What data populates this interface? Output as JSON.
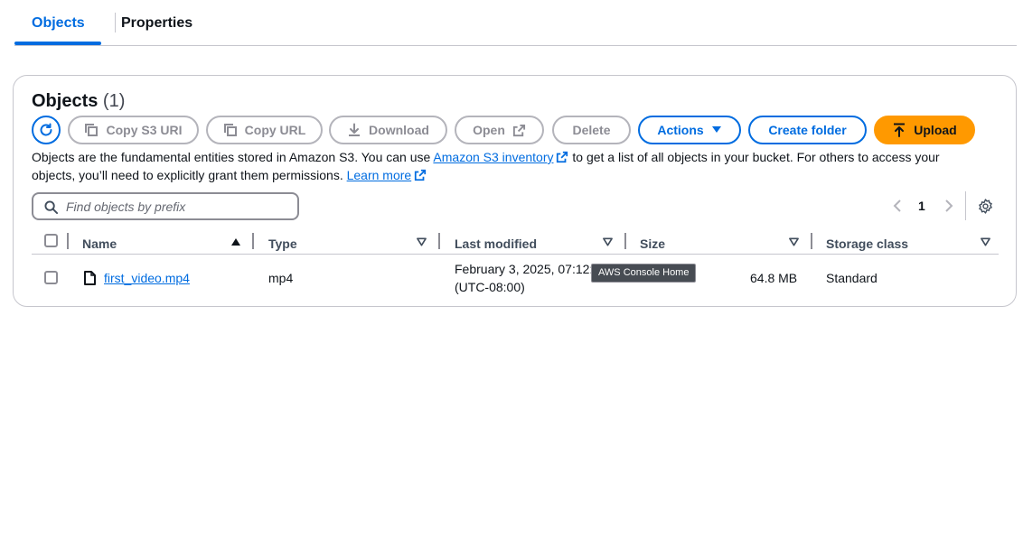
{
  "tabs": [
    {
      "label": "Objects",
      "active": true
    },
    {
      "label": "Properties",
      "active": false
    }
  ],
  "header": {
    "title": "Objects",
    "count": "(1)"
  },
  "toolbar": {
    "copy_s3_uri": "Copy S3 URI",
    "copy_url": "Copy URL",
    "download": "Download",
    "open": "Open",
    "delete": "Delete",
    "actions": "Actions",
    "create_folder": "Create folder",
    "upload": "Upload"
  },
  "description": {
    "part1": "Objects are the fundamental entities stored in Amazon S3. You can use ",
    "inventory_link": "Amazon S3 inventory",
    "part2": " to get a list of all objects in your bucket. For others to access your objects, you’ll need to explicitly grant them permissions. ",
    "learn_more": "Learn more"
  },
  "search": {
    "placeholder": "Find objects by prefix",
    "value": ""
  },
  "pagination": {
    "current_page": "1"
  },
  "table": {
    "columns": [
      "Name",
      "Type",
      "Last modified",
      "Size",
      "Storage class"
    ],
    "rows": [
      {
        "name": "first_video.mp4",
        "type": "mp4",
        "last_modified_line1": "February 3, 2025, 07:12:",
        "last_modified_line2": "(UTC-08:00)",
        "size": "64.8 MB",
        "storage_class": "Standard"
      }
    ]
  },
  "tooltip": {
    "text": "AWS Console Home"
  },
  "colors": {
    "accent": "#006ce0",
    "upload": "#ff9900",
    "border": "#c6c6cd"
  },
  "icons": [
    "refresh-icon",
    "copy-icon",
    "download-icon",
    "external-link-icon",
    "caret-down-icon",
    "upload-icon",
    "search-icon",
    "chevron-left-icon",
    "chevron-right-icon",
    "gear-icon",
    "file-icon",
    "sort-ascending-icon",
    "sort-icon"
  ]
}
